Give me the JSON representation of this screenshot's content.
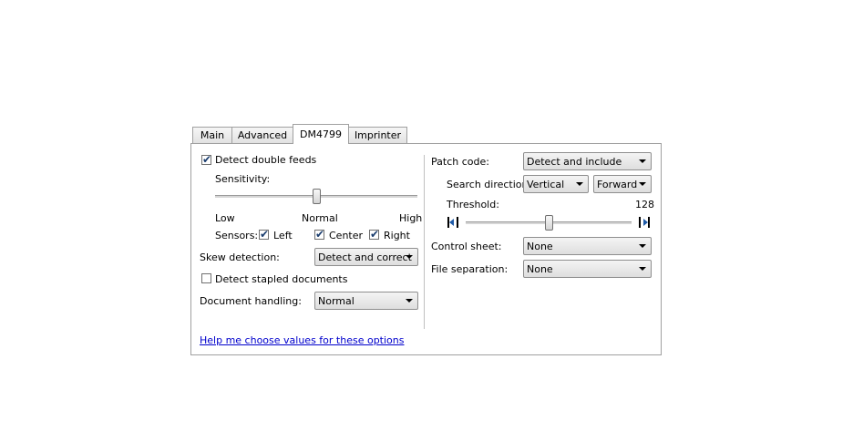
{
  "tabs": [
    {
      "label": "Main"
    },
    {
      "label": "Advanced"
    },
    {
      "label": "DM4799"
    },
    {
      "label": "Imprinter"
    }
  ],
  "left": {
    "detect_double_feeds": {
      "label": "Detect double feeds",
      "checked": true
    },
    "sensitivity_label": "Sensitivity:",
    "sensitivity_scale": {
      "low": "Low",
      "normal": "Normal",
      "high": "High"
    },
    "sensors": {
      "label": "Sensors:",
      "left": {
        "label": "Left",
        "checked": true
      },
      "center": {
        "label": "Center",
        "checked": true
      },
      "right": {
        "label": "Right",
        "checked": true
      }
    },
    "skew_detection": {
      "label": "Skew detection:",
      "value": "Detect and correct"
    },
    "detect_stapled": {
      "label": "Detect stapled documents",
      "checked": false
    },
    "document_handling": {
      "label": "Document handling:",
      "value": "Normal"
    }
  },
  "right": {
    "patch_code": {
      "label": "Patch code:",
      "value": "Detect and include"
    },
    "search_direction": {
      "label": "Search direction:",
      "value1": "Vertical",
      "value2": "Forward"
    },
    "threshold": {
      "label": "Threshold:",
      "value": "128"
    },
    "control_sheet": {
      "label": "Control sheet:",
      "value": "None"
    },
    "file_separation": {
      "label": "File separation:",
      "value": "None"
    }
  },
  "help_link": "Help me choose values for these options",
  "colors": {
    "link": "#0000cc",
    "border": "#a0a0a0"
  }
}
